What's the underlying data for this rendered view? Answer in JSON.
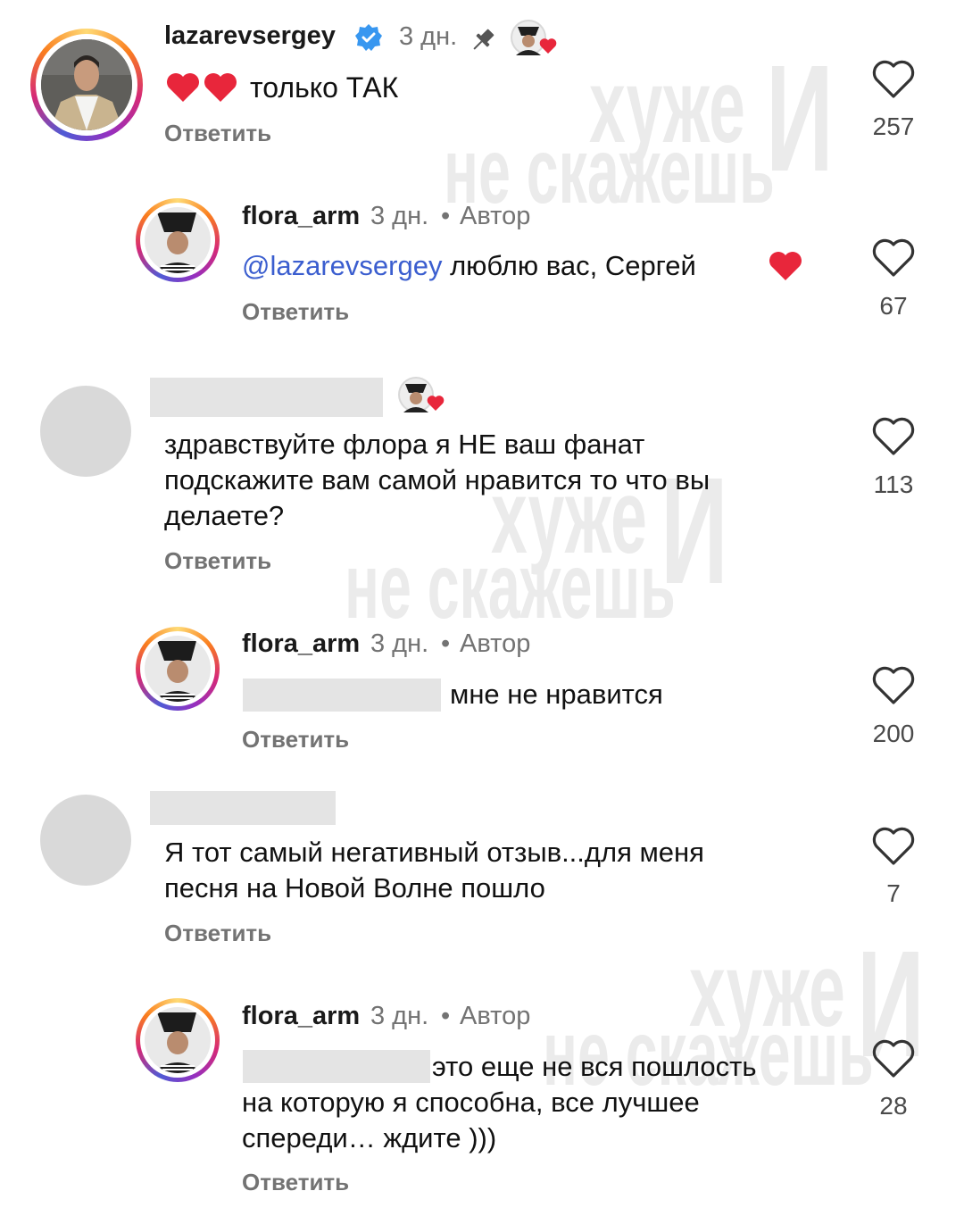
{
  "watermark": {
    "line1": "хуже",
    "line2": "не скажешь",
    "letter": "И"
  },
  "comments": [
    {
      "username": "lazarevsergey",
      "time": "3 дн.",
      "text": "только ТАК",
      "reply_label": "Ответить",
      "likes": "257",
      "verified": true,
      "pinned": true
    },
    {
      "username": "flora_arm",
      "time": "3 дн.",
      "author_badge": "Автор",
      "mention": "@lazarevsergey",
      "text": "люблю вас, Сергей",
      "reply_label": "Ответить",
      "likes": "67"
    },
    {
      "username": "",
      "text_lines": [
        "здравствуйте флора я НЕ ваш фанат",
        "подскажите вам самой нравится то что вы",
        "делаете?"
      ],
      "reply_label": "Ответить",
      "likes": "113"
    },
    {
      "username": "flora_arm",
      "time": "3 дн.",
      "author_badge": "Автор",
      "text": "мне не нравится",
      "reply_label": "Ответить",
      "likes": "200"
    },
    {
      "username": "",
      "text_lines": [
        "Я тот самый негативный отзыв...для меня",
        "песня на Новой Волне пошло"
      ],
      "reply_label": "Ответить",
      "likes": "7"
    },
    {
      "username": "flora_arm",
      "time": "3 дн.",
      "author_badge": "Автор",
      "text_lines": [
        "это еще не вся пошлость",
        "на которую я способна, все лучшее",
        "спереди… ждите )))"
      ],
      "reply_label": "Ответить",
      "likes": "28"
    }
  ],
  "colors": {
    "ring_start": "#feda75",
    "ring_end": "#962fbf",
    "verified": "#3897f0",
    "mention": "#3b5ecf",
    "heart_red": "#e8263b"
  },
  "separator": "•"
}
